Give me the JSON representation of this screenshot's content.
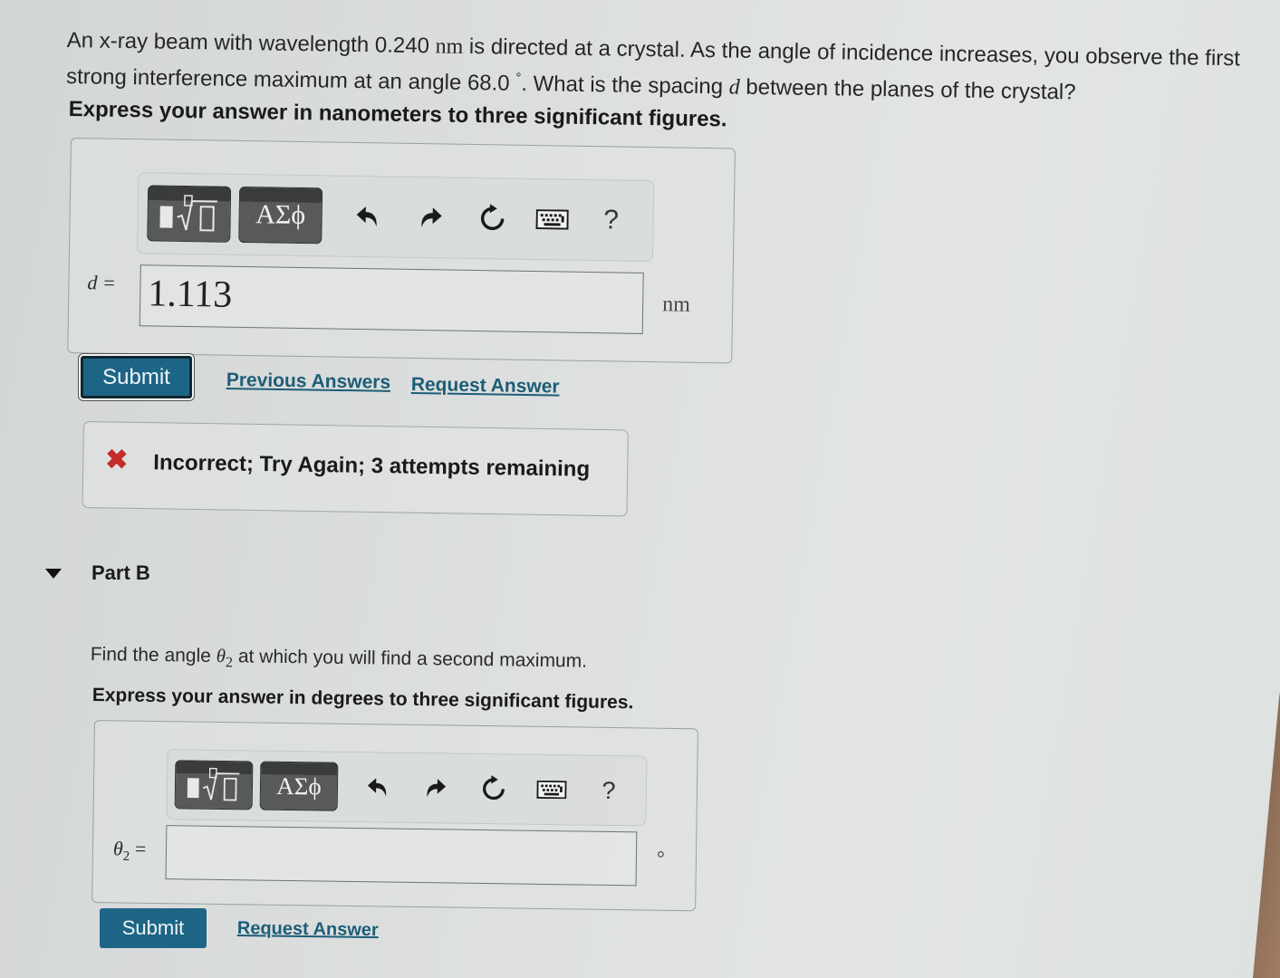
{
  "part_a": {
    "question": {
      "p1": "An x-ray beam with wavelength 0.240 ",
      "unit_nm": "nm",
      "p2": " is directed at a crystal. As the angle of incidence increases, you observe the first strong interference maximum at an angle 68.0 ",
      "degree": "°",
      "p3": ". What is the spacing ",
      "var_d": "d",
      "p4": " between the planes of the crystal?"
    },
    "instruction": "Express your answer in nanometers to three significant figures.",
    "toolbar": {
      "template_icon": "template-radical-icon",
      "greek_label": "ΑΣϕ",
      "undo_icon": "↶",
      "redo_icon": "↷",
      "reset_icon": "↻",
      "keyboard_icon": "keyboard-icon",
      "help_label": "?"
    },
    "input_label": "d =",
    "input_value": "1.113",
    "unit": "nm",
    "submit_label": "Submit",
    "previous_answers_label": "Previous Answers",
    "request_answer_label": "Request Answer",
    "feedback": {
      "icon": "✖",
      "message": "Incorrect; Try Again; 3 attempts remaining"
    }
  },
  "part_b": {
    "title": "Part B",
    "question": {
      "p1": "Find the angle ",
      "var": "θ",
      "sub": "2",
      "p2": " at which you will find a second maximum."
    },
    "instruction": "Express your answer in degrees to three significant figures.",
    "toolbar": {
      "greek_label": "ΑΣϕ",
      "undo_icon": "↶",
      "redo_icon": "↷",
      "reset_icon": "↻",
      "help_label": "?"
    },
    "input_label_var": "θ",
    "input_label_sub": "2",
    "input_label_eq": "=",
    "input_value": "",
    "unit": "°",
    "submit_label": "Submit",
    "request_answer_label": "Request Answer"
  },
  "colors": {
    "submit_bg": "#1d6586",
    "link": "#1d5d78",
    "error": "#c42b2b",
    "tool_btn": "#58595a"
  }
}
